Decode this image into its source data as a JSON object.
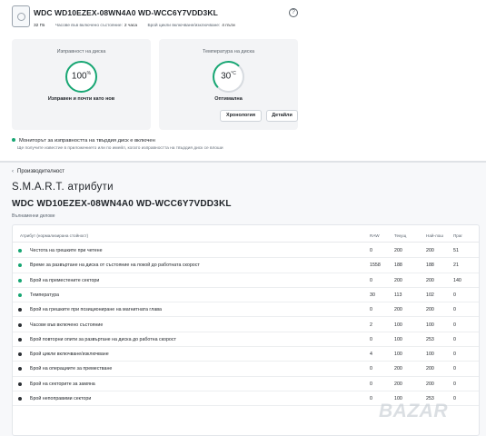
{
  "header": {
    "disk_title": "WDC WD10EZEX-08WN4A0 WD-WCC6Y7VDD3KL",
    "meta": [
      {
        "label": "",
        "value": "32 ГБ"
      },
      {
        "label": "Часове във включено състояние:",
        "value": "2 часа"
      },
      {
        "label": "Брой цикли включване/изключване:",
        "value": "4 пъти"
      }
    ]
  },
  "health_panel": {
    "title": "Изправност на диска",
    "value": "100",
    "unit": "%",
    "status": "Изправен и почти като нов"
  },
  "temp_panel": {
    "title": "Температура на диска",
    "value": "30",
    "unit": "°C",
    "status": "Оптимална"
  },
  "buttons": {
    "history": "Хронология",
    "details": "Детайли"
  },
  "monitor": {
    "label": "Мониторът за изправността на твърдия диск е включен",
    "sub": "Ще получите известие в приложението или по имейл, когато изправността на твърдия диск се влоши"
  },
  "lower": {
    "back_label": "Производителност",
    "smart_title": "S.M.A.R.T. атрибути",
    "disk_title": "WDC WD10EZEX-08WN4A0 WD-WCC6Y7VDD3KL",
    "disk_sub": "Вълнаменни делове"
  },
  "table": {
    "headers": {
      "name": "Атрибут (нормализирана стойност)",
      "raw": "RAW",
      "current": "Текущ",
      "worst": "Най-лош",
      "threshold": "Праг"
    },
    "rows": [
      {
        "status": "good",
        "name": "Честота на грешките при четене",
        "raw": "0",
        "current": "200",
        "worst": "200",
        "threshold": "51"
      },
      {
        "status": "good",
        "name": "Време за развъртане на диска от състояние на покой до работната скорост",
        "raw": "1558",
        "current": "188",
        "worst": "188",
        "threshold": "21"
      },
      {
        "status": "good",
        "name": "Брой на преместените сектори",
        "raw": "0",
        "current": "200",
        "worst": "200",
        "threshold": "140"
      },
      {
        "status": "good",
        "name": "Температура",
        "raw": "30",
        "current": "113",
        "worst": "102",
        "threshold": "0"
      },
      {
        "status": "neutral",
        "name": "Брой на грешките при позициониране на магнитната глава",
        "raw": "0",
        "current": "200",
        "worst": "200",
        "threshold": "0"
      },
      {
        "status": "neutral",
        "name": "Часове във включено състояние",
        "raw": "2",
        "current": "100",
        "worst": "100",
        "threshold": "0"
      },
      {
        "status": "neutral",
        "name": "Брой повторни опити за развъртане на диска до работна скорост",
        "raw": "0",
        "current": "100",
        "worst": "253",
        "threshold": "0"
      },
      {
        "status": "neutral",
        "name": "Брой цикли включване/изключване",
        "raw": "4",
        "current": "100",
        "worst": "100",
        "threshold": "0"
      },
      {
        "status": "neutral",
        "name": "Брой на операциите за преместване",
        "raw": "0",
        "current": "200",
        "worst": "200",
        "threshold": "0"
      },
      {
        "status": "neutral",
        "name": "Брой на секторите за замяна",
        "raw": "0",
        "current": "200",
        "worst": "200",
        "threshold": "0"
      },
      {
        "status": "neutral",
        "name": "Брой непоправими сектори",
        "raw": "0",
        "current": "100",
        "worst": "253",
        "threshold": "0"
      }
    ]
  },
  "colors": {
    "good": "#17a673",
    "neutral": "#2b2f33"
  },
  "watermark": "BAZAR"
}
